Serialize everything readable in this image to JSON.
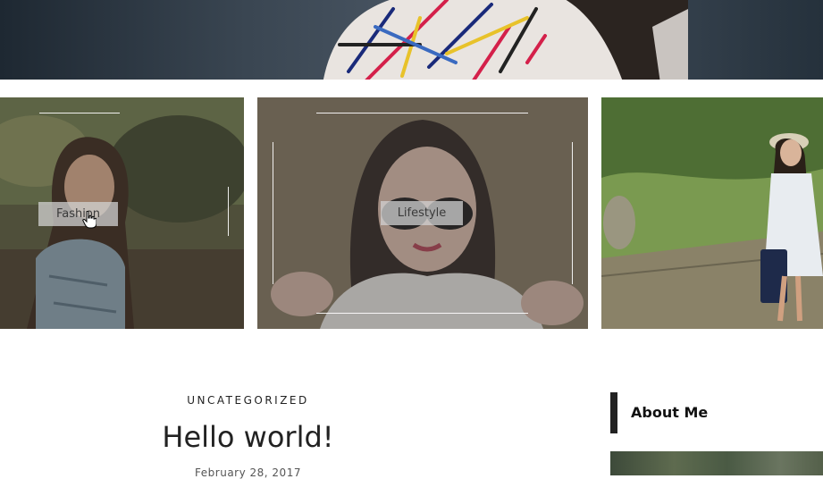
{
  "categories": [
    {
      "label": "Fashion"
    },
    {
      "label": "Lifestyle"
    },
    {
      "label": ""
    }
  ],
  "post": {
    "category": "UNCATEGORIZED",
    "title": "Hello world!",
    "date": "February 28, 2017"
  },
  "sidebar": {
    "widget_title": "About Me"
  },
  "icons": {
    "cursor": "hand-pointer-icon"
  }
}
